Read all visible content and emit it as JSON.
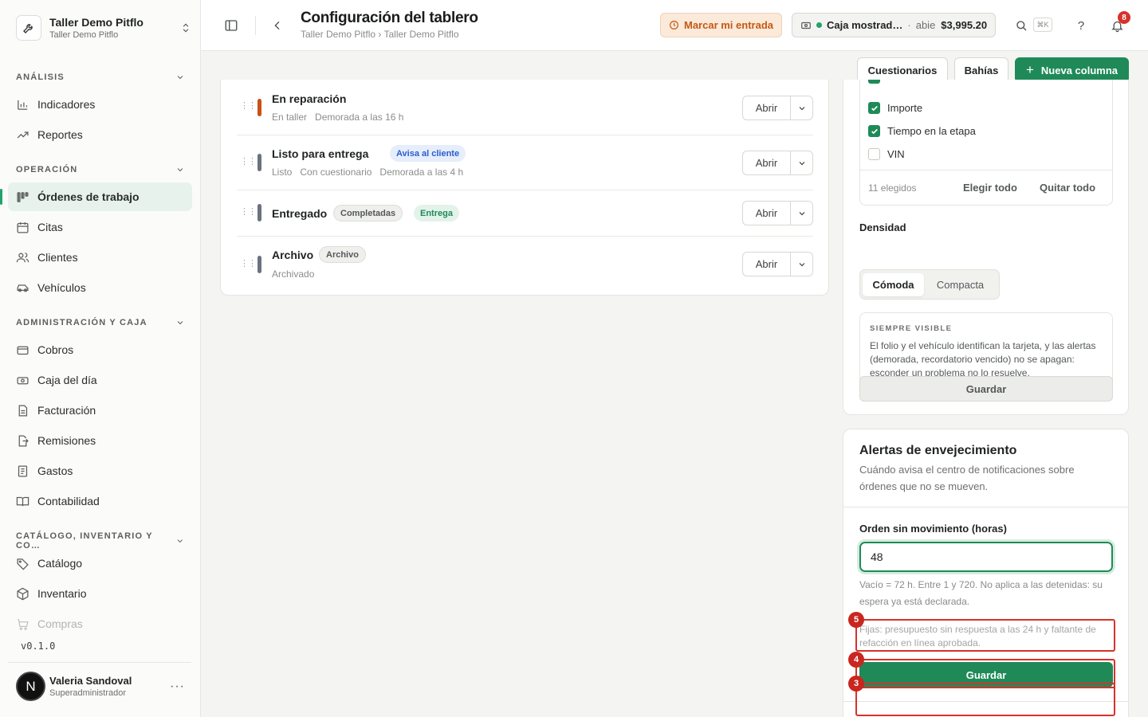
{
  "workspace": {
    "name": "Taller Demo Pitflo",
    "subtitle": "Taller Demo Pitflo"
  },
  "sidebar": {
    "sections": [
      {
        "label": "ANÁLISIS"
      },
      {
        "label": "OPERACIÓN"
      },
      {
        "label": "ADMINISTRACIÓN Y CAJA"
      },
      {
        "label": "CATÁLOGO, INVENTARIO Y CO…"
      }
    ],
    "items": [
      {
        "label": "Indicadores",
        "icon": "bar-chart-icon"
      },
      {
        "label": "Reportes",
        "icon": "trend-up-icon"
      },
      {
        "label": "Órdenes de trabajo",
        "icon": "kanban-icon",
        "active": true
      },
      {
        "label": "Citas",
        "icon": "calendar-icon"
      },
      {
        "label": "Clientes",
        "icon": "users-icon"
      },
      {
        "label": "Vehículos",
        "icon": "car-icon"
      },
      {
        "label": "Cobros",
        "icon": "credit-card-icon"
      },
      {
        "label": "Caja del día",
        "icon": "cash-register-icon"
      },
      {
        "label": "Facturación",
        "icon": "invoice-icon"
      },
      {
        "label": "Remisiones",
        "icon": "file-export-icon"
      },
      {
        "label": "Gastos",
        "icon": "receipt-icon"
      },
      {
        "label": "Contabilidad",
        "icon": "book-icon"
      },
      {
        "label": "Catálogo",
        "icon": "tag-icon"
      },
      {
        "label": "Inventario",
        "icon": "box-icon"
      },
      {
        "label": "Compras",
        "icon": "cart-icon"
      }
    ],
    "version": "v0.1.0",
    "user": {
      "initial": "N",
      "name": "Valeria Sandoval",
      "role": "Superadministrador"
    }
  },
  "header": {
    "title": "Configuración del tablero",
    "breadcrumb": "Taller Demo Pitflo › Taller Demo Pitflo",
    "clock_in_label": "Marcar mi entrada",
    "cash": {
      "name": "Caja mostrad…",
      "separator": "·",
      "status": "abie",
      "amount": "$3,995.20"
    },
    "shortcut": "⌘K",
    "help": "?",
    "notifications_count": "8"
  },
  "toolbar": {
    "questionnaires": "Cuestionarios",
    "bays": "Bahías",
    "new_column": "Nueva columna"
  },
  "columns": [
    {
      "name": "En reparación",
      "color": "#c7521a",
      "meta": [
        "En taller",
        "Demorada a las 16 h"
      ],
      "tags": [],
      "action": "Abrir"
    },
    {
      "name": "Listo para entrega",
      "color": "#6b7280",
      "meta": [
        "Listo",
        "Con cuestionario",
        "Demorada a las 4 h"
      ],
      "tags": [
        "Avisa al cliente"
      ],
      "action": "Abrir"
    },
    {
      "name": "Entregado",
      "color": "#6b7280",
      "meta": [],
      "tags": [
        "Completadas",
        "Entrega"
      ],
      "action": "Abrir"
    },
    {
      "name": "Archivo",
      "color": "#6b7280",
      "meta": [
        "Archivado"
      ],
      "tags": [
        "Archivo"
      ],
      "action": "Abrir"
    }
  ],
  "card_fields": {
    "options": [
      {
        "label": "Importe",
        "checked": true
      },
      {
        "label": "Tiempo en la etapa",
        "checked": true
      },
      {
        "label": "VIN",
        "checked": false
      }
    ],
    "selected_count": "11 elegidos",
    "select_all": "Elegir todo",
    "clear_all": "Quitar todo",
    "density_label": "Densidad",
    "density_options": [
      "Cómoda",
      "Compacta"
    ],
    "density_selected": "Cómoda",
    "always_visible_title": "SIEMPRE VISIBLE",
    "always_visible_text": "El folio y el vehículo identifican la tarjeta, y las alertas (demorada, recordatorio vencido) no se apagan: esconder un problema no lo resuelve.",
    "save": "Guardar"
  },
  "aging_alerts": {
    "title": "Alertas de envejecimiento",
    "description": "Cuándo avisa el centro de notificaciones sobre órdenes que no se mueven.",
    "field_label": "Orden sin movimiento (horas)",
    "field_value": "48",
    "help": "Vacío = 72 h. Entre 1 y 720. No aplica a las detenidas: su espera ya está declarada.",
    "fixed_note": "Fijas: presupuesto sin respuesta a las 24 h y faltante de refacción en línea aprobada.",
    "save": "Guardar"
  },
  "annotations": [
    "5",
    "4",
    "3"
  ],
  "colors": {
    "accent": "#1f8a58",
    "annotation": "#d6322b",
    "warning": "#c25a13"
  }
}
